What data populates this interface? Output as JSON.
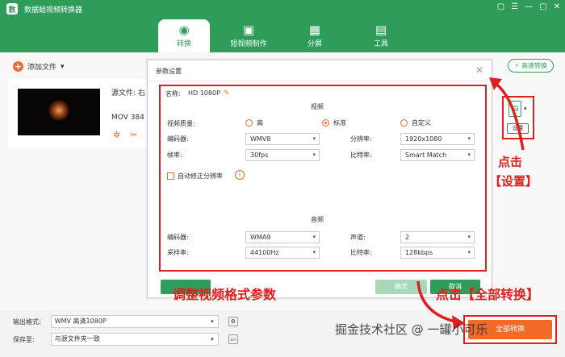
{
  "app": {
    "title": "数据蛙视频转换器",
    "logo": "数"
  },
  "window_controls": [
    "▢",
    "☰",
    "—",
    "▢",
    "✕"
  ],
  "tabs": [
    {
      "label": "转换",
      "icon": "◉",
      "active": true
    },
    {
      "label": "短视频制作",
      "icon": "▣",
      "active": false
    },
    {
      "label": "分屏",
      "icon": "▦",
      "active": false
    },
    {
      "label": "工具",
      "icon": "▤",
      "active": false
    }
  ],
  "toolbar": {
    "add_file": "添加文件",
    "fast_convert": "高速转换"
  },
  "file": {
    "source_label": "源文件: 右",
    "format_label": "MOV  384"
  },
  "format_panel": {
    "setting_label": "设置"
  },
  "bottom": {
    "output_format_label": "输出格式:",
    "output_format_value": "WMV 高清1080P",
    "save_to_label": "保存至:",
    "save_to_value": "与源文件夹一致",
    "merge_label": "合并",
    "convert_all": "全部转换"
  },
  "dialog": {
    "title": "参数设置",
    "name_label": "名称:",
    "name_value": "HD 1080P",
    "video_section": "视频",
    "audio_section": "音频",
    "quality_label": "视频质量:",
    "quality_options": [
      "高",
      "标准",
      "自定义"
    ],
    "quality_selected": "标准",
    "video_encoder_label": "编码器:",
    "video_encoder_value": "WMV8",
    "resolution_label": "分辨率:",
    "resolution_value": "1920x1080",
    "framerate_label": "帧率:",
    "framerate_value": "30fps",
    "bitrate_label": "比特率:",
    "bitrate_value": "Smart Match",
    "auto_fix_label": "自动修正分辨率",
    "audio_encoder_label": "编码器:",
    "audio_encoder_value": "WMA9",
    "channel_label": "声道:",
    "channel_value": "2",
    "samplerate_label": "采样率:",
    "samplerate_value": "44100Hz",
    "audio_bitrate_label": "比特率:",
    "audio_bitrate_value": "128kbps",
    "btn_confirm": "确定",
    "btn_cancel": "取消"
  },
  "annotations": {
    "click_label": "点击",
    "settings_bracket": "【设置】",
    "adjust_params": "调整视频格式参数",
    "click_convert_all": "点击【全部转换】"
  },
  "watermark": "掘金技术社区 @ 一罐小可乐",
  "colors": {
    "brand": "#2f9c5a",
    "accent": "#f06a28",
    "annotation": "#e02020"
  }
}
